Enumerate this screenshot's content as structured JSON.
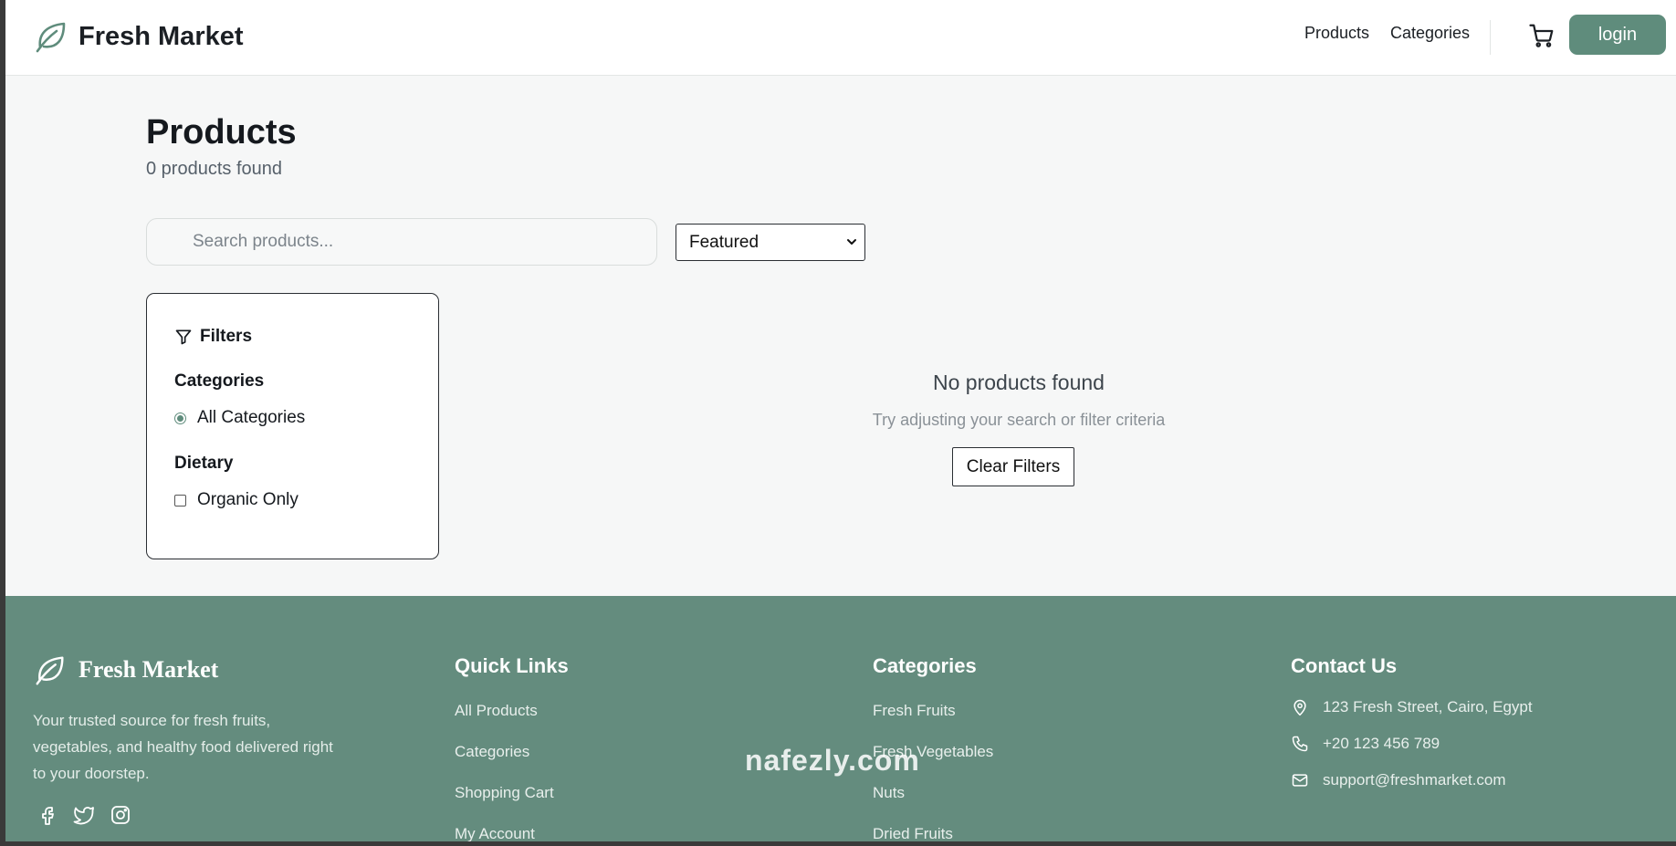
{
  "header": {
    "brand": "Fresh Market",
    "nav": [
      "Products",
      "Categories"
    ],
    "login_label": "login"
  },
  "main": {
    "title": "Products",
    "count_text": "0 products found",
    "search_placeholder": "Search products...",
    "sort_selected": "Featured",
    "filters": {
      "title": "Filters",
      "categories_heading": "Categories",
      "category_option": "All Categories",
      "dietary_heading": "Dietary",
      "dietary_option": "Organic Only",
      "category_selected": true,
      "organic_checked": false
    },
    "empty": {
      "title": "No products found",
      "subtitle": "Try adjusting your search or filter criteria",
      "clear_label": "Clear Filters"
    }
  },
  "footer": {
    "brand": "Fresh Market",
    "description": "Your trusted source for fresh fruits, vegetables, and healthy food delivered right to your doorstep.",
    "quick_links": {
      "title": "Quick Links",
      "items": [
        "All Products",
        "Categories",
        "Shopping Cart",
        "My Account"
      ]
    },
    "categories": {
      "title": "Categories",
      "items": [
        "Fresh Fruits",
        "Fresh Vegetables",
        "Nuts",
        "Dried Fruits"
      ]
    },
    "contact": {
      "title": "Contact Us",
      "address": "123 Fresh Street, Cairo, Egypt",
      "phone": "+20 123 456 789",
      "email": "support@freshmarket.com"
    }
  },
  "watermark": "nafezly.com",
  "colors": {
    "accent": "#5f8c7c",
    "footer_bg": "#648c7e",
    "page_bg": "#f6f7f7"
  },
  "icons": [
    "leaf-icon",
    "cart-icon",
    "search-icon",
    "filter-icon",
    "facebook-icon",
    "twitter-icon",
    "instagram-icon",
    "map-pin-icon",
    "phone-icon",
    "mail-icon"
  ]
}
